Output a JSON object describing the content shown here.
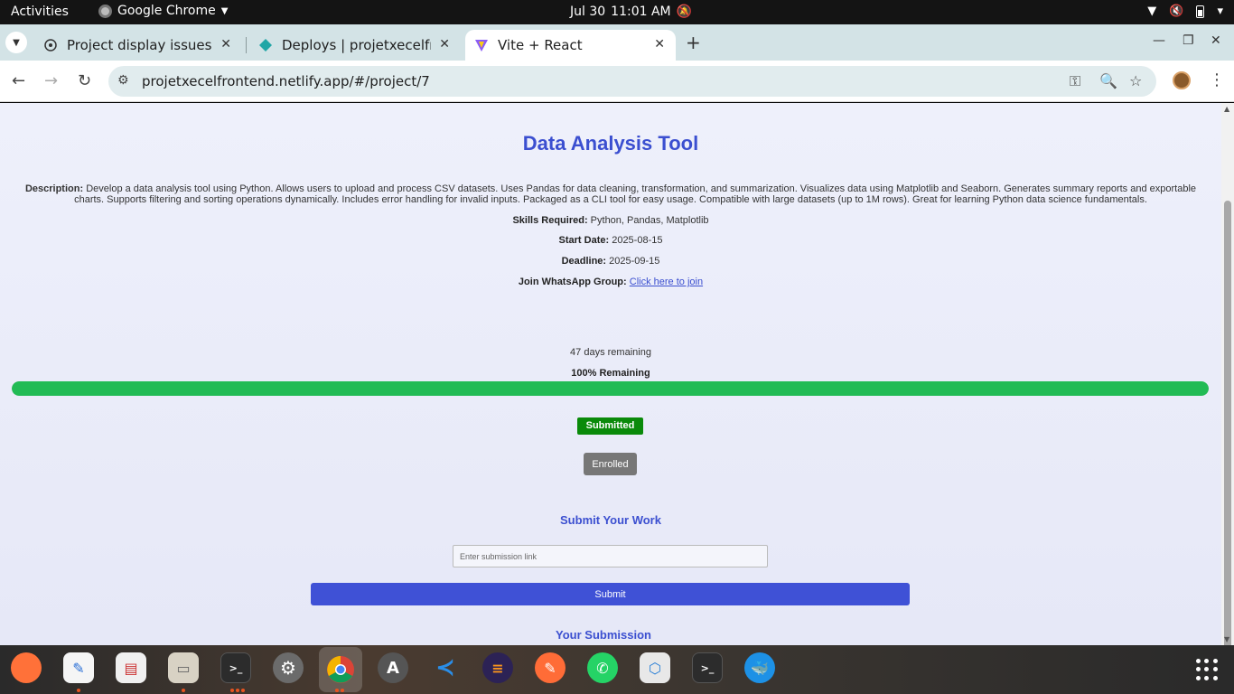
{
  "system": {
    "activities": "Activities",
    "app_name": "Google Chrome",
    "date": "Jul 30",
    "time": "11:01 AM"
  },
  "browser": {
    "tabs": [
      {
        "title": "Project display issues",
        "icon": "openai-icon"
      },
      {
        "title": "Deploys | projetxecelfrontend",
        "icon": "netlify-icon"
      },
      {
        "title": "Vite + React",
        "icon": "vite-icon",
        "active": true
      }
    ],
    "url": "projetxecelfrontend.netlify.app/#/project/7"
  },
  "project": {
    "title": "Data Analysis Tool",
    "description_label": "Description:",
    "description": "Develop a data analysis tool using Python. Allows users to upload and process CSV datasets. Uses Pandas for data cleaning, transformation, and summarization. Visualizes data using Matplotlib and Seaborn. Generates summary reports and exportable charts. Supports filtering and sorting operations dynamically. Includes error handling for invalid inputs. Packaged as a CLI tool for easy usage. Compatible with large datasets (up to 1M rows). Great for learning Python data science fundamentals.",
    "skills_label": "Skills Required:",
    "skills": "Python, Pandas, Matplotlib",
    "start_label": "Start Date:",
    "start_date": "2025-08-15",
    "deadline_label": "Deadline:",
    "deadline": "2025-09-15",
    "whatsapp_label": "Join WhatsApp Group:",
    "whatsapp_link": "Click here to join"
  },
  "progress": {
    "days_remaining": "47 days remaining",
    "percent_label": "100% Remaining",
    "fraction": 1.0,
    "color": "#22bb55"
  },
  "status": {
    "submitted": "Submitted",
    "enrolled": "Enrolled"
  },
  "submission": {
    "heading": "Submit Your Work",
    "placeholder": "Enter submission link",
    "button": "Submit",
    "your_heading": "Your Submission"
  },
  "dock": [
    "firefox-icon",
    "text-editor-icon",
    "document-viewer-icon",
    "files-icon",
    "terminal-icon",
    "settings-icon",
    "chrome-icon",
    "software-updater-icon",
    "vscode-icon",
    "eclipse-icon",
    "postman-icon",
    "whatsapp-icon",
    "box-app-icon",
    "terminal-2-icon",
    "docker-icon"
  ]
}
